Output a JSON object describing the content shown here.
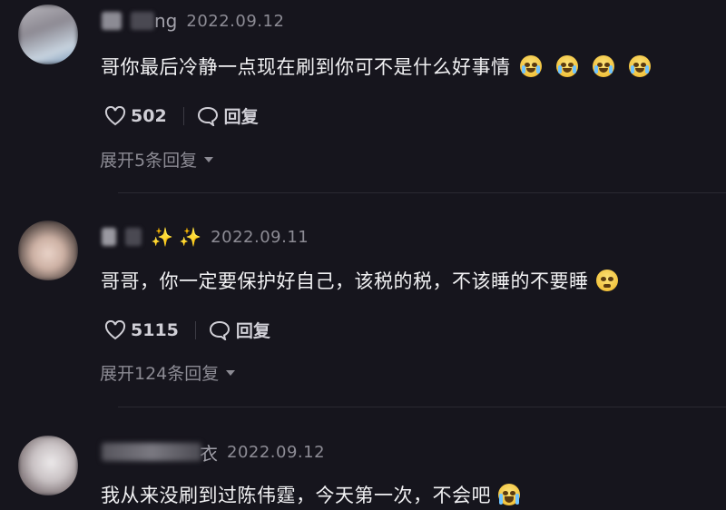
{
  "comments": [
    {
      "username_visible": "ng",
      "date": "2022.09.12",
      "text": "哥你最后冷静一点现在刷到你可不是什么好事情",
      "emoji_count": 4,
      "likes": "502",
      "reply_label": "回复",
      "expand_label": "展开5条回复"
    },
    {
      "username_visible": "✨ ✨",
      "date": "2022.09.11",
      "text": "哥哥，你一定要保护好自己，该税的税，不该睡的不要睡",
      "emoji_count": 1,
      "likes": "5115",
      "reply_label": "回复",
      "expand_label": "展开124条回复"
    },
    {
      "username_visible": "衣",
      "date": "2022.09.12",
      "text": "我从来没刷到过陈伟霆，今天第一次，不会吧",
      "emoji_count": 1
    }
  ],
  "icons": {
    "like": "heart-outline-icon",
    "reply": "speech-bubble-icon",
    "expand": "caret-down-icon",
    "emoji": "crying-face-emoji"
  },
  "colors": {
    "background": "#16151d",
    "text_primary": "#f1f1f3",
    "text_secondary": "#8c8b94"
  }
}
